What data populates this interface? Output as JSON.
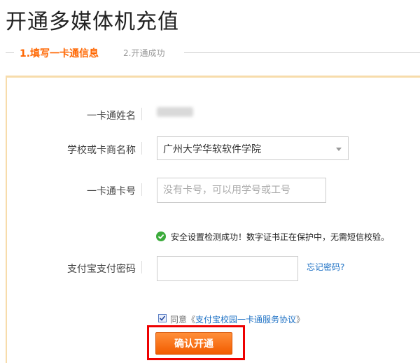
{
  "page": {
    "title": "开通多媒体机充值"
  },
  "steps": [
    {
      "label": "1.填写一卡通信息",
      "active": true
    },
    {
      "label": "2.开通成功",
      "active": false
    }
  ],
  "form": {
    "name_label": "一卡通姓名",
    "school_label": "学校或卡商名称",
    "school_value": "广州大学华软软件学院",
    "card_label": "一卡通卡号",
    "card_placeholder": "没有卡号，可以用学号或工号",
    "security_msg": "安全设置检测成功！数字证书正在保护中，无需短信校验。",
    "pwd_label": "支付宝支付密码",
    "forgot_link": "忘记密码?",
    "agree_prefix": "同意《",
    "agree_link": "支付宝校园一卡通服务协议",
    "agree_suffix": "》",
    "agree_checked": true,
    "confirm_label": "确认开通"
  },
  "colors": {
    "accent": "#ff6600",
    "link": "#1a6fc4",
    "panel_border": "#f7dcab",
    "success": "#3bab3b",
    "highlight": "#ee0000"
  },
  "icons": {
    "success": "check-circle-icon",
    "select_caret": "chevron-down-icon",
    "checkbox": "checkmark-icon"
  }
}
